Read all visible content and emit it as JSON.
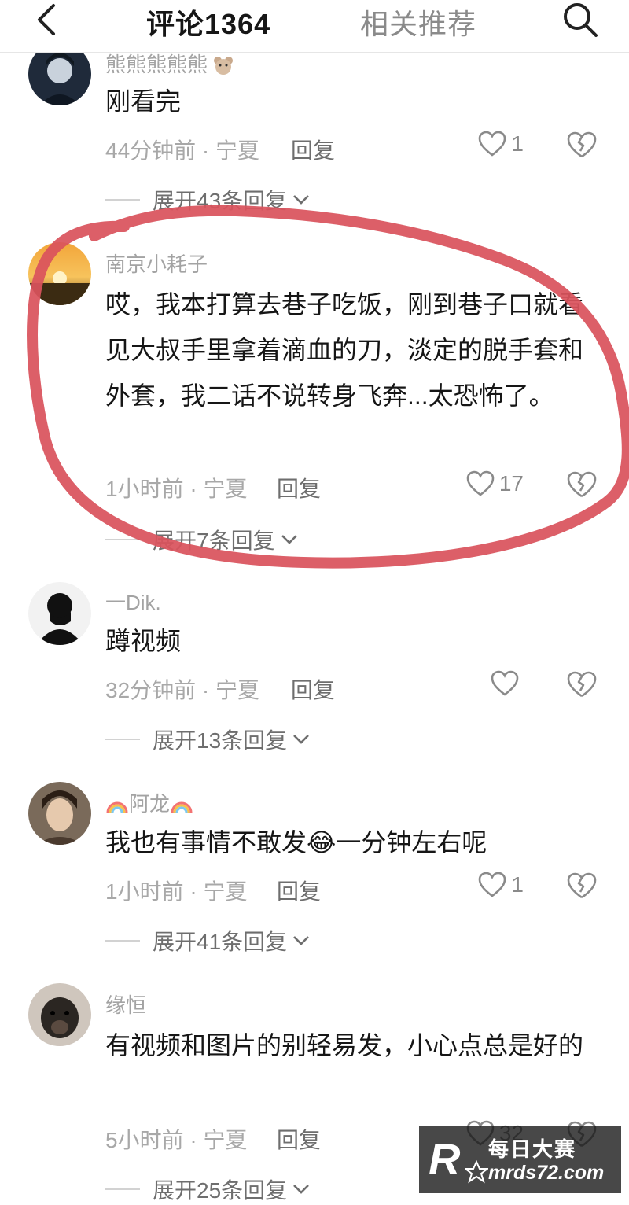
{
  "header": {
    "tab_comments_label": "评论1364",
    "tab_recommend_label": "相关推荐"
  },
  "comments": [
    {
      "username": "熊熊熊熊熊",
      "text": "刚看完",
      "time_location": "44分钟前 · 宁夏",
      "reply_label": "回复",
      "like_count": "1",
      "expand_label": "展开43条回复"
    },
    {
      "username": "南京小耗子",
      "text": "哎，我本打算去巷子吃饭，刚到巷子口就看见大叔手里拿着滴血的刀，淡定的脱手套和外套，我二话不说转身飞奔...太恐怖了。",
      "time_location": "1小时前 · 宁夏",
      "reply_label": "回复",
      "like_count": "17",
      "expand_label": "展开7条回复"
    },
    {
      "username": "一Dik.",
      "text": "蹲视频",
      "time_location": "32分钟前 · 宁夏",
      "reply_label": "回复",
      "like_count": "",
      "expand_label": "展开13条回复"
    },
    {
      "username": "阿龙",
      "text": "我也有事情不敢发😂一分钟左右呢",
      "time_location": "1小时前 · 宁夏",
      "reply_label": "回复",
      "like_count": "1",
      "expand_label": "展开41条回复"
    },
    {
      "username": "缘恒",
      "text": "有视频和图片的别轻易发，小心点总是好的",
      "time_location": "5小时前 · 宁夏",
      "reply_label": "回复",
      "like_count": "32",
      "expand_label": "展开25条回复"
    }
  ],
  "watermark": {
    "logo": "R",
    "title": "每日大赛",
    "url": "mrds72.com"
  },
  "colors": {
    "annotation": "#d9535c",
    "muted_text": "#a8a8a8",
    "primary_text": "#161616"
  }
}
